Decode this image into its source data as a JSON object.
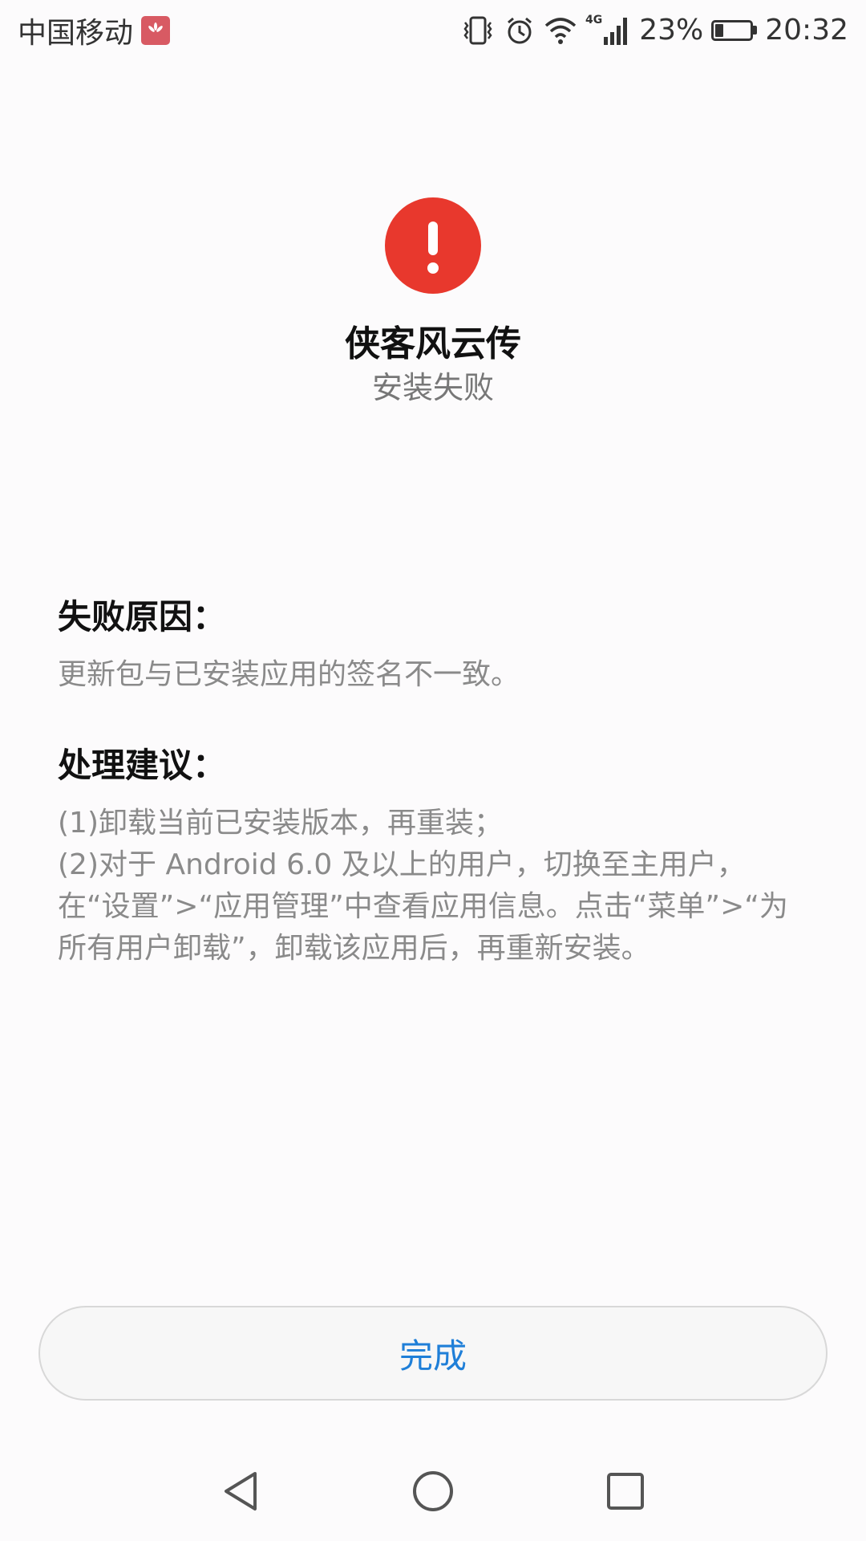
{
  "status_bar": {
    "carrier": "中国移动",
    "network_type": "4G",
    "battery_percent": "23%",
    "battery_level": 0.23,
    "time": "20:32",
    "icons": [
      "huawei-logo-icon",
      "vibrate-icon",
      "alarm-icon",
      "wifi-icon",
      "signal-icon",
      "battery-icon"
    ]
  },
  "header": {
    "icon": "error-exclamation-icon",
    "icon_color": "#e8382d",
    "app_name": "侠客风云传",
    "status": "安装失败"
  },
  "failure": {
    "title": "失败原因：",
    "reason": "更新包与已安装应用的签名不一致。"
  },
  "suggestion": {
    "title": "处理建议：",
    "lines": [
      "(1)卸载当前已安装版本，再重装；",
      "(2)对于 Android 6.0 及以上的用户，切换至主用户，",
      "在“设置”>“应用管理”中查看应用信息。点击“菜单”>“为",
      "所有用户卸载”，卸载该应用后，再重新安装。"
    ]
  },
  "actions": {
    "done_label": "完成",
    "accent": "#1f7fd8"
  },
  "nav_bar": {
    "icons": [
      "back-icon",
      "home-icon",
      "recents-icon"
    ]
  }
}
